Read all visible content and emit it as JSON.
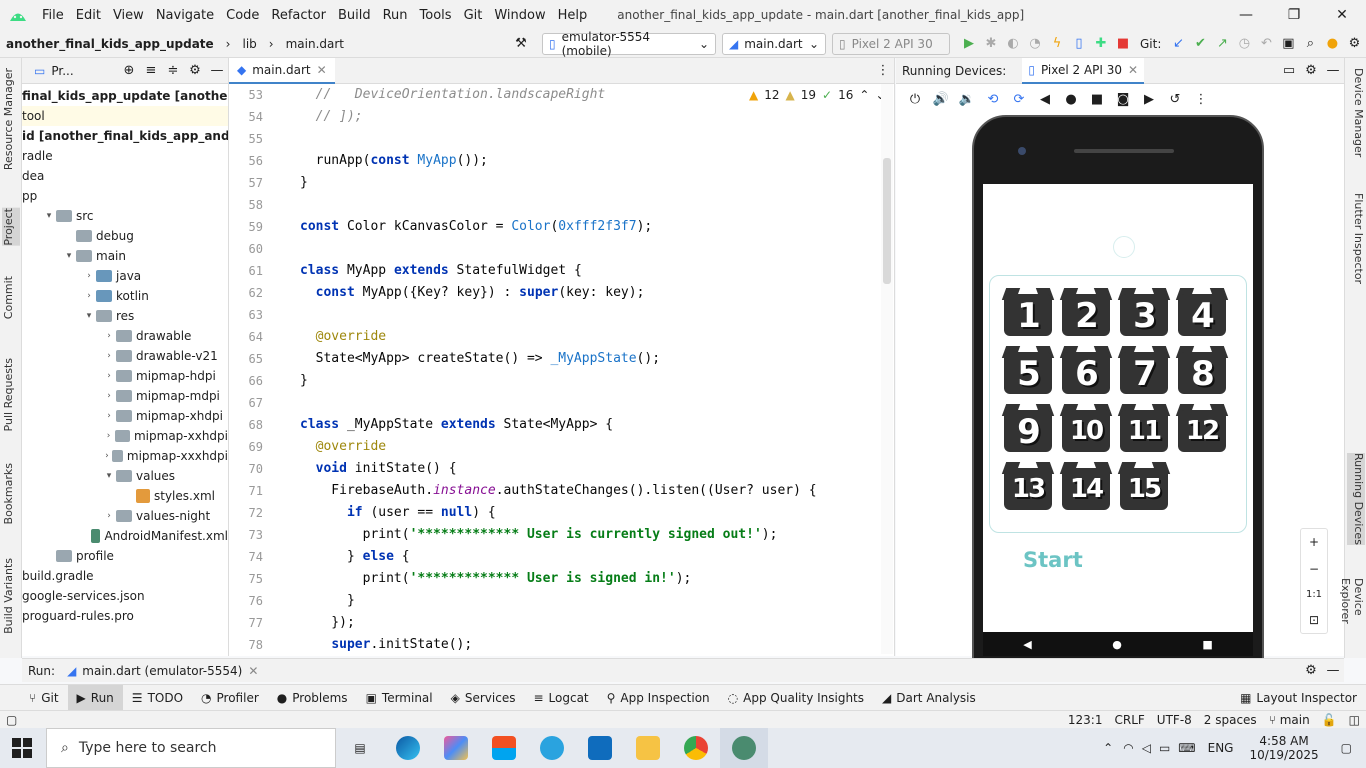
{
  "titlebar": {
    "menu": [
      "File",
      "Edit",
      "View",
      "Navigate",
      "Code",
      "Refactor",
      "Build",
      "Run",
      "Tools",
      "Git",
      "Window",
      "Help"
    ],
    "window_title": "another_final_kids_app_update - main.dart [another_final_kids_app]",
    "brand_color": "#3ddc84"
  },
  "navbar": {
    "project": "another_final_kids_app_update",
    "folder": "lib",
    "file": "main.dart",
    "device_combo": "emulator-5554 (mobile)",
    "run_config": "main.dart",
    "avd_combo": "Pixel 2 API 30",
    "git_label": "Git:"
  },
  "left_stripe": [
    "Resource Manager",
    "Project",
    "Commit",
    "Pull Requests",
    "Bookmarks",
    "Build Variants"
  ],
  "project_panel": {
    "title": "Pr...",
    "rows": [
      {
        "label": "final_kids_app_update [another_final_kids_app]",
        "bold": true,
        "indent": 0,
        "arrow": "",
        "icon": "none"
      },
      {
        "label": "tool",
        "indent": 0,
        "arrow": "",
        "icon": "none",
        "highlight": true
      },
      {
        "label": "id [another_final_kids_app_android]",
        "bold": true,
        "indent": 0,
        "arrow": "",
        "icon": "none"
      },
      {
        "label": "radle",
        "indent": 0,
        "arrow": "",
        "icon": "none"
      },
      {
        "label": "dea",
        "indent": 0,
        "arrow": "",
        "icon": "none"
      },
      {
        "label": "pp",
        "indent": 0,
        "arrow": "",
        "icon": "none"
      },
      {
        "label": "src",
        "indent": 1,
        "arrow": "▾",
        "icon": "folder"
      },
      {
        "label": "debug",
        "indent": 2,
        "arrow": "",
        "icon": "folder"
      },
      {
        "label": "main",
        "indent": 2,
        "arrow": "▾",
        "icon": "folder"
      },
      {
        "label": "java",
        "indent": 3,
        "arrow": "›",
        "icon": "folder-blue"
      },
      {
        "label": "kotlin",
        "indent": 3,
        "arrow": "›",
        "icon": "folder-blue"
      },
      {
        "label": "res",
        "indent": 3,
        "arrow": "▾",
        "icon": "folder"
      },
      {
        "label": "drawable",
        "indent": 4,
        "arrow": "›",
        "icon": "folder"
      },
      {
        "label": "drawable-v21",
        "indent": 4,
        "arrow": "›",
        "icon": "folder"
      },
      {
        "label": "mipmap-hdpi",
        "indent": 4,
        "arrow": "›",
        "icon": "folder"
      },
      {
        "label": "mipmap-mdpi",
        "indent": 4,
        "arrow": "›",
        "icon": "folder"
      },
      {
        "label": "mipmap-xhdpi",
        "indent": 4,
        "arrow": "›",
        "icon": "folder"
      },
      {
        "label": "mipmap-xxhdpi",
        "indent": 4,
        "arrow": "›",
        "icon": "folder"
      },
      {
        "label": "mipmap-xxxhdpi",
        "indent": 4,
        "arrow": "›",
        "icon": "folder"
      },
      {
        "label": "values",
        "indent": 4,
        "arrow": "▾",
        "icon": "folder"
      },
      {
        "label": "styles.xml",
        "indent": 5,
        "arrow": "",
        "icon": "xml"
      },
      {
        "label": "values-night",
        "indent": 4,
        "arrow": "›",
        "icon": "folder"
      },
      {
        "label": "AndroidManifest.xml",
        "indent": 3,
        "arrow": "",
        "icon": "mf"
      },
      {
        "label": "profile",
        "indent": 1,
        "arrow": "",
        "icon": "folder"
      },
      {
        "label": "build.gradle",
        "indent": 0,
        "arrow": "",
        "icon": "none"
      },
      {
        "label": "google-services.json",
        "indent": 0,
        "arrow": "",
        "icon": "none"
      },
      {
        "label": "proguard-rules.pro",
        "indent": 0,
        "arrow": "",
        "icon": "none"
      }
    ]
  },
  "editor": {
    "tab": "main.dart",
    "warnings": "12",
    "weak_warnings": "19",
    "checks": "16",
    "lines": [
      {
        "n": "53",
        "html": "<span class=\"cm\">  //   DeviceOrientation.landscapeRight</span>"
      },
      {
        "n": "54",
        "html": "<span class=\"cm\">  // ]);</span>"
      },
      {
        "n": "55",
        "html": ""
      },
      {
        "n": "56",
        "html": "  runApp(<span class=\"kw\">const</span> <span class=\"cl\">MyApp</span>());"
      },
      {
        "n": "57",
        "html": "}"
      },
      {
        "n": "58",
        "html": ""
      },
      {
        "n": "59",
        "html": "<span class=\"kw\">const</span> Color kCanvasColor = <span class=\"cl\">Color</span>(<span class=\"cl\">0xfff2f3f7</span>);"
      },
      {
        "n": "60",
        "html": ""
      },
      {
        "n": "61",
        "html": "<span class=\"kw\">class</span> MyApp <span class=\"kw\">extends</span> StatefulWidget {"
      },
      {
        "n": "62",
        "html": "  <span class=\"kw\">const</span> MyApp({Key? key}) : <span class=\"kw\">super</span>(key: key);"
      },
      {
        "n": "63",
        "html": ""
      },
      {
        "n": "64",
        "html": "  <span class=\"an\">@override</span>"
      },
      {
        "n": "65",
        "html": "  State&lt;MyApp&gt; createState() =&gt; <span class=\"cl\">_MyAppState</span>();"
      },
      {
        "n": "66",
        "html": "}"
      },
      {
        "n": "67",
        "html": ""
      },
      {
        "n": "68",
        "html": "<span class=\"kw\">class</span> _MyAppState <span class=\"kw\">extends</span> State&lt;MyApp&gt; {"
      },
      {
        "n": "69",
        "html": "  <span class=\"an\">@override</span>"
      },
      {
        "n": "70",
        "html": "  <span class=\"kw\">void</span> initState() {"
      },
      {
        "n": "71",
        "html": "    FirebaseAuth.<span class=\"it\">instance</span>.authStateChanges().listen((User? user) {"
      },
      {
        "n": "72",
        "html": "      <span class=\"kw\">if</span> (user == <span class=\"kw\">null</span>) {"
      },
      {
        "n": "73",
        "html": "        print(<span class=\"st\">'************* User is currently signed out!'</span>);"
      },
      {
        "n": "74",
        "html": "      } <span class=\"kw\">else</span> {"
      },
      {
        "n": "75",
        "html": "        print(<span class=\"st\">'************* User is signed in!'</span>);"
      },
      {
        "n": "76",
        "html": "      }"
      },
      {
        "n": "77",
        "html": "    });"
      },
      {
        "n": "78",
        "html": "    <span class=\"kw\">super</span>.initState();"
      }
    ]
  },
  "devices": {
    "header": "Running Devices:",
    "tab": "Pixel 2 API 30",
    "levels": [
      "1",
      "2",
      "3",
      "4",
      "5",
      "6",
      "7",
      "8",
      "9",
      "10",
      "11",
      "12",
      "13",
      "14",
      "15"
    ],
    "start_label": "Start",
    "start_color": "#6cc4c4",
    "zoom": [
      "+",
      "−",
      "1:1",
      "⊡"
    ]
  },
  "right_stripe": [
    "Device Manager",
    "Flutter Inspector",
    "Running Devices",
    "Device Explorer"
  ],
  "runbar": {
    "label": "Run:",
    "config": "main.dart (emulator-5554)"
  },
  "toolwindows": [
    "Git",
    "Run",
    "TODO",
    "Profiler",
    "Problems",
    "Terminal",
    "Services",
    "Logcat",
    "App Inspection",
    "App Quality Insights",
    "Dart Analysis"
  ],
  "layout_inspector": "Layout Inspector",
  "status": {
    "position": "123:1",
    "line_sep": "CRLF",
    "encoding": "UTF-8",
    "indent": "2 spaces",
    "branch": "main"
  },
  "taskbar": {
    "search_placeholder": "Type here to search",
    "time": "4:58 AM",
    "date": "10/19/2025",
    "lang": "ENG"
  }
}
